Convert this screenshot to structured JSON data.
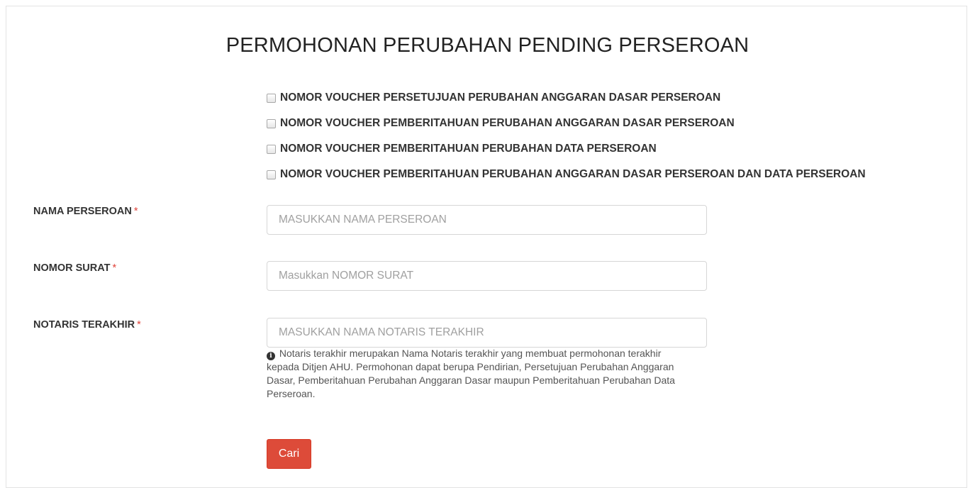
{
  "page": {
    "title": "PERMOHONAN PERUBAHAN PENDING PERSEROAN"
  },
  "voucher_options": [
    {
      "label": "NOMOR VOUCHER PERSETUJUAN PERUBAHAN ANGGARAN DASAR PERSEROAN",
      "checked": false
    },
    {
      "label": "NOMOR VOUCHER PEMBERITAHUAN PERUBAHAN ANGGARAN DASAR PERSEROAN",
      "checked": false
    },
    {
      "label": "NOMOR VOUCHER PEMBERITAHUAN PERUBAHAN DATA PERSEROAN",
      "checked": false
    },
    {
      "label": "NOMOR VOUCHER PEMBERITAHUAN PERUBAHAN ANGGARAN DASAR PERSEROAN DAN DATA PERSEROAN",
      "checked": false
    }
  ],
  "form": {
    "company_name": {
      "label": "NAMA PERSEROAN",
      "required_mark": "*",
      "placeholder": "MASUKKAN NAMA PERSEROAN",
      "value": ""
    },
    "letter_number": {
      "label": "NOMOR SURAT",
      "required_mark": "*",
      "placeholder": "Masukkan NOMOR SURAT",
      "value": ""
    },
    "last_notary": {
      "label": "NOTARIS TERAKHIR",
      "required_mark": "*",
      "placeholder": "MASUKKAN NAMA NOTARIS TERAKHIR",
      "value": "",
      "help_text": "Notaris terakhir merupakan Nama Notaris terakhir yang membuat permohonan terakhir kepada Ditjen AHU. Permohonan dapat berupa Pendirian, Persetujuan Perubahan Anggaran Dasar, Pemberitahuan Perubahan Anggaran Dasar maupun Pemberitahuan Perubahan Data Perseroan."
    },
    "submit_label": "Cari"
  },
  "icons": {
    "help": "info-circle-icon"
  },
  "colors": {
    "button": "#dd4b39",
    "required": "#e0443b"
  }
}
